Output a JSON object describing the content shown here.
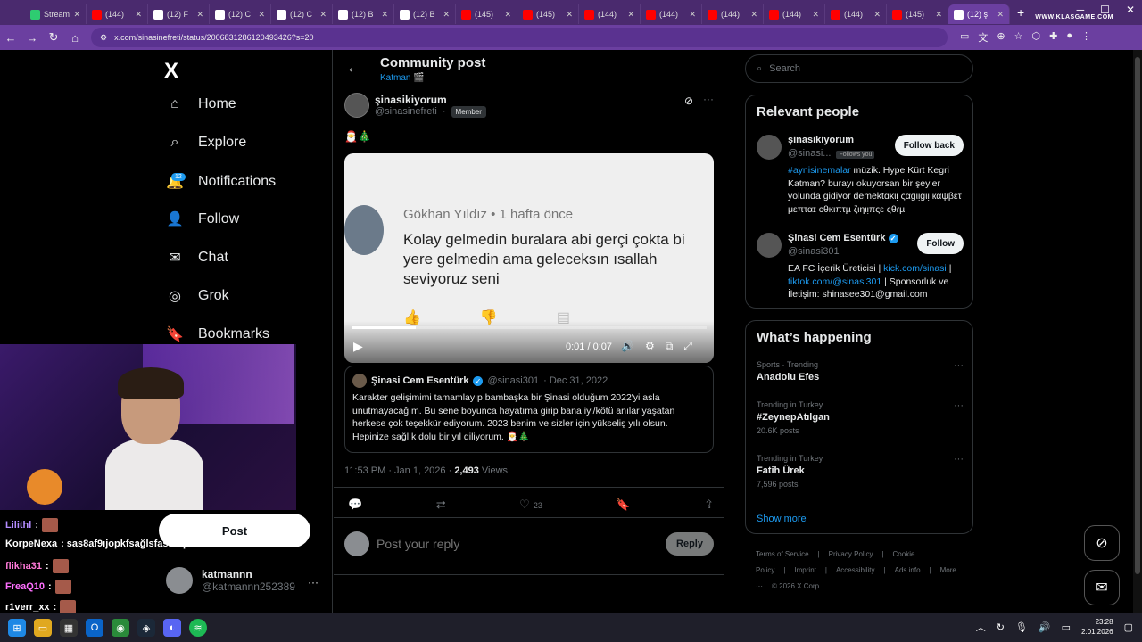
{
  "browser": {
    "tabs": [
      {
        "label": "Stream",
        "color": "#2ecc71"
      },
      {
        "label": "(144)",
        "color": "#ff0000"
      },
      {
        "label": "(12) F",
        "color": "#ffffff"
      },
      {
        "label": "(12) C",
        "color": "#ffffff"
      },
      {
        "label": "(12) C",
        "color": "#ffffff"
      },
      {
        "label": "(12) B",
        "color": "#ffffff"
      },
      {
        "label": "(12) B",
        "color": "#ffffff"
      },
      {
        "label": "(145)",
        "color": "#ff0000"
      },
      {
        "label": "(145)",
        "color": "#ff0000"
      },
      {
        "label": "(144)",
        "color": "#ff0000"
      },
      {
        "label": "(144)",
        "color": "#ff0000"
      },
      {
        "label": "(144)",
        "color": "#ff0000"
      },
      {
        "label": "(144)",
        "color": "#ff0000"
      },
      {
        "label": "(144)",
        "color": "#ff0000"
      },
      {
        "label": "(145)",
        "color": "#ff0000"
      },
      {
        "label": "(12) ş",
        "color": "#ffffff"
      }
    ],
    "url": "x.com/sinasinefreti/status/2006831286120493426?s=20",
    "watermark": "WWW.KLASGAME.COM"
  },
  "sidebar": {
    "logo": "X",
    "items": [
      {
        "label": "Home",
        "icon": "⌂"
      },
      {
        "label": "Explore",
        "icon": "⌕"
      },
      {
        "label": "Notifications",
        "icon": "🔔"
      },
      {
        "label": "Follow",
        "icon": "👤"
      },
      {
        "label": "Chat",
        "icon": "✉"
      },
      {
        "label": "Grok",
        "icon": "◎"
      },
      {
        "label": "Bookmarks",
        "icon": "🔖"
      }
    ],
    "notif_badge": "12",
    "post_label": "Post",
    "account": {
      "name": "katmannn",
      "handle": "@katmannn252389"
    }
  },
  "stream_chat": [
    {
      "user": "Lilithl",
      "color": "#b48cff",
      "msg": ":"
    },
    {
      "user": "KorpeNexa",
      "color": "#ffffff",
      "msg": ": sas8af9ıjopkfsağlsfasafopk"
    },
    {
      "user": "flikha31",
      "color": "#ff7ad9",
      "msg": ":"
    },
    {
      "user": "FreaQ10",
      "color": "#ff6fff",
      "msg": ":"
    },
    {
      "user": "r1verr_xx",
      "color": "#ffffff",
      "msg": ":"
    }
  ],
  "header": {
    "title": "Community post",
    "subtitle": "Katman 🎬"
  },
  "post": {
    "author_name": "şinasikiyorum",
    "author_handle": "@sinasinefreti",
    "dot": "·",
    "member_badge": "Member",
    "emojis": "🎅🎄",
    "video": {
      "comment_author": "Gökhan Yıldız • 1 hafta önce",
      "comment_text": "Kolay gelmedin buralara abi gerçi çokta bi yere gelmedin ama geleceksın ısallah seviyoruz seni",
      "time": "0:01 / 0:07",
      "progress": 0.18
    },
    "quote": {
      "name": "Şinasi Cem Esentürk",
      "handle": "@sinasi301",
      "date": "· Dec 31, 2022",
      "text": "Karakter gelişimimi tamamlayıp bambaşka bir Şinasi olduğum 2022'yi asla unutmayacağım. Bu sene boyunca hayatıma girip bana iyi/kötü anılar yaşatan herkese çok teşekkür ediyorum. 2023 benim ve sizler için yükseliş yılı olsun. Hepinize sağlık dolu bir yıl diliyorum. 🎅🎄"
    },
    "timestamp": "11:53 PM · Jan 1, 2026 · ",
    "views_count": "2,493",
    "views_label": " Views",
    "like_count": "23",
    "reply_placeholder": "Post your reply",
    "reply_button": "Reply"
  },
  "right": {
    "search_placeholder": "Search",
    "relevant_title": "Relevant people",
    "people": [
      {
        "name": "şinasikiyorum",
        "handle": "@sinasi...",
        "follows_you": "Follows you",
        "button": "Follow back",
        "bio_link": "#aynisinemalar",
        "bio_text": " müzik. Hype Kürt Kegri Katman? burayı okuyorsan bir şeyler yolunda gidiyor demektɑκιᴉ ςαɡιᴉɡιᴉ кαψβετ μεπταɪ сθκιπτµ ζιηιᴉπςε ςθɾµ"
      },
      {
        "name": "Şinasi Cem Esentürk",
        "handle": "@sinasi301",
        "button": "Follow",
        "bio_pre": "EA FC İçerik Üreticisi | ",
        "bio_link1": "kick.com/sinasi",
        "bio_mid": " | ",
        "bio_link2": "tiktok.com/@sinasi301",
        "bio_post": " | Sponsorluk ve İletişim: shinasee301@gmail.com"
      }
    ],
    "happening_title": "What’s happening",
    "trends": [
      {
        "category": "Sports · Trending",
        "name": "Anadolu Efes",
        "posts": ""
      },
      {
        "category": "Trending in Turkey",
        "name": "#ZeynepAtılgan",
        "posts": "20.6K posts"
      },
      {
        "category": "Trending in Turkey",
        "name": "Fatih Ürek",
        "posts": "7,596 posts"
      }
    ],
    "show_more": "Show more",
    "footer": [
      "Terms of Service",
      "|",
      "Privacy Policy",
      "|",
      "Cookie Policy",
      "|",
      "Imprint",
      "|",
      "Accessibility",
      "|",
      "Ads info",
      "|",
      "More ···",
      "© 2026 X Corp."
    ]
  },
  "taskbar": {
    "time": "23:28",
    "date": "2.01.2026"
  }
}
